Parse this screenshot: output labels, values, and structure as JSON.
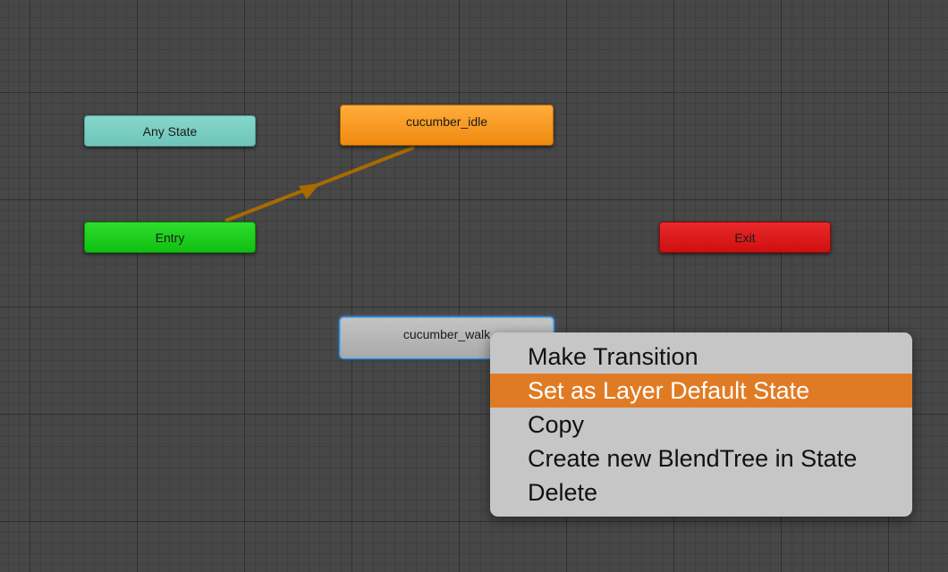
{
  "graph": {
    "nodes": {
      "any_state": "Any State",
      "entry": "Entry",
      "exit": "Exit",
      "idle": "cucumber_idle",
      "walk": "cucumber_walk"
    }
  },
  "context_menu": {
    "items": [
      {
        "label": "Make Transition"
      },
      {
        "label": "Set as Layer Default State",
        "highlighted": true
      },
      {
        "label": "Copy"
      },
      {
        "label": "Create new BlendTree in State"
      },
      {
        "label": "Delete"
      }
    ]
  },
  "colors": {
    "canvas_background": "#474747",
    "any_state": "#72c8bc",
    "entry": "#16c416",
    "exit": "#d81414",
    "default_state": "#f5961f",
    "state": "#b5b5b5",
    "selection_outline": "#3f8fd6",
    "transition_arrow": "#a96a00",
    "menu_background": "#c6c6c6",
    "menu_highlight": "#e07b25"
  }
}
